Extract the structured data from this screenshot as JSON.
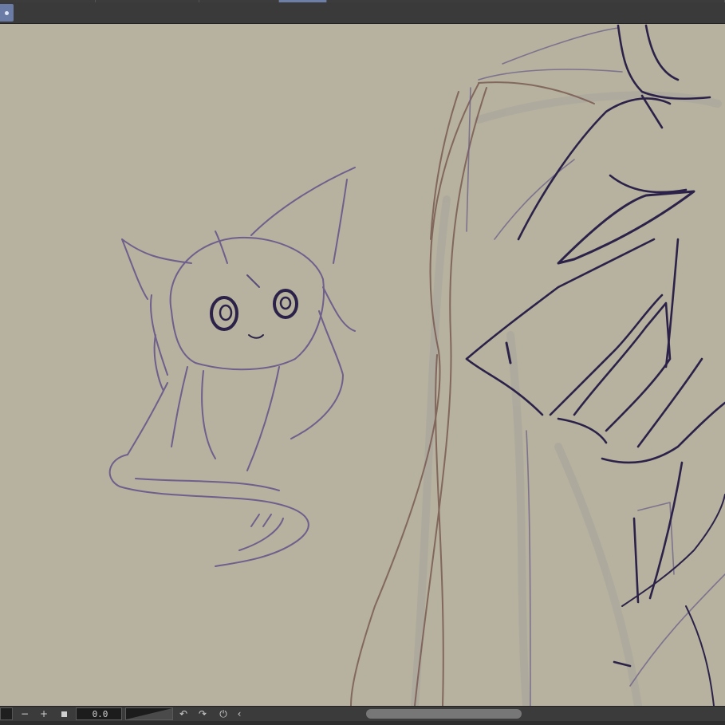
{
  "toolbar": {
    "active_tool_icon": "dot-icon"
  },
  "statusbar": {
    "zoom_out_label": "−",
    "zoom_in_label": "+",
    "rotation_value": "0.0",
    "rotate_left_icon": "↶",
    "rotate_right_icon": "↷",
    "reset_icon": "⏻",
    "collapse_icon": "‹"
  },
  "colors": {
    "canvas_background": "#b6b29f",
    "sketch_purple": "#4a3a6e",
    "sketch_light_purple": "#7b6c93",
    "sketch_brown": "#7a5a52",
    "sketch_dark": "#2c2148",
    "accent_blue": "#6a7ca6"
  }
}
